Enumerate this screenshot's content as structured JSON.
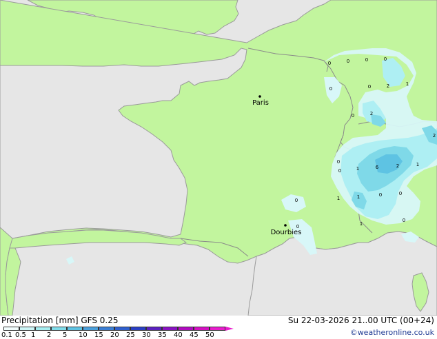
{
  "map": {
    "cities": [
      {
        "name": "Paris"
      },
      {
        "name": "Dourbies"
      }
    ],
    "precip_labels": [
      "0",
      "0",
      "0",
      "0",
      "0",
      "0",
      "2",
      "1",
      "0",
      "2",
      "2",
      "0",
      "0",
      "1",
      "6",
      "2",
      "1",
      "1",
      "0",
      "1",
      "0",
      "0",
      "0",
      "1",
      "0"
    ]
  },
  "footer": {
    "title": "Precipitation [mm]  GFS 0.25",
    "datetime": "Su 22-03-2026 21..00 UTC (00+24)",
    "credit": "©weatheronline.co.uk",
    "scale_labels": [
      "0.1",
      "0.5",
      "1",
      "2",
      "5",
      "10",
      "15",
      "20",
      "25",
      "30",
      "35",
      "40",
      "45",
      "50"
    ],
    "scale_colors": [
      "#f2fdfd",
      "#cdf6f7",
      "#a6eef1",
      "#7fdcea",
      "#5ec3e3",
      "#4aa0dc",
      "#3b7fd6",
      "#2f5fce",
      "#2a3fc5",
      "#5b21c0",
      "#8a12c2",
      "#b10cc0",
      "#d510c2",
      "#e91ccd"
    ]
  }
}
